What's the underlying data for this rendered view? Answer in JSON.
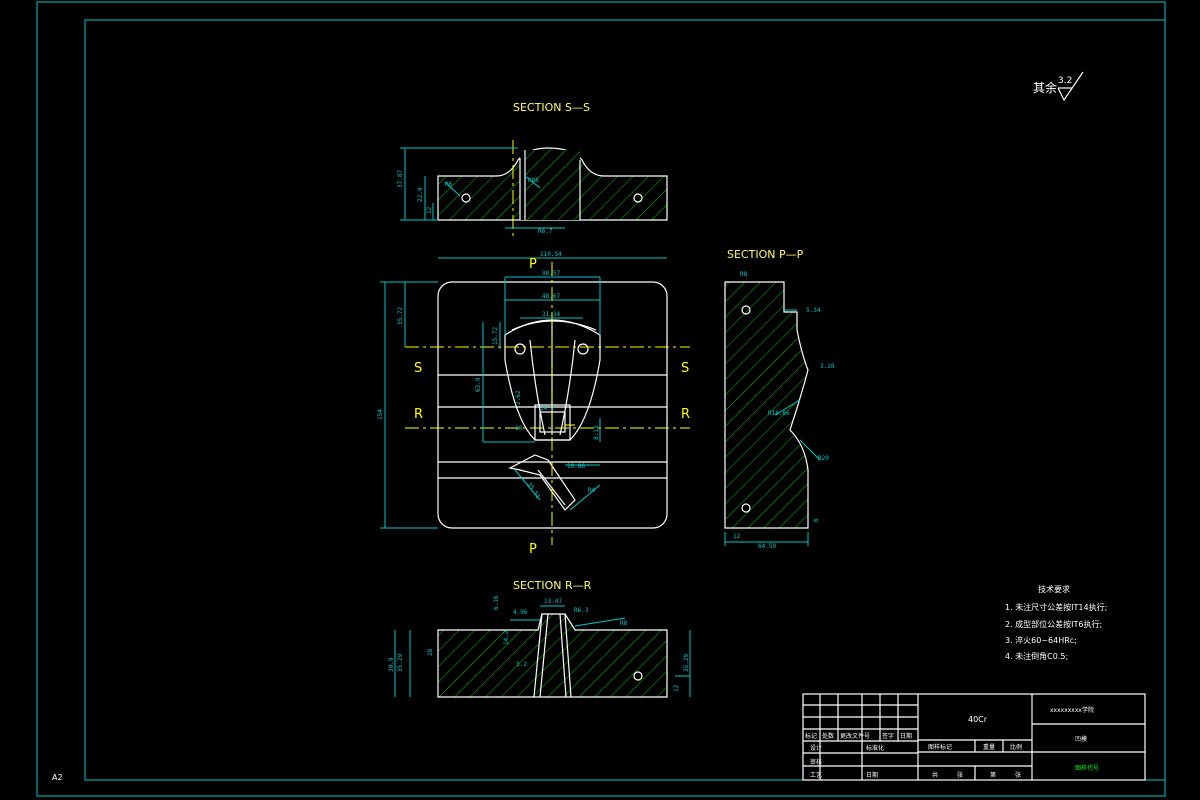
{
  "sheet": {
    "size_label": "A2"
  },
  "sections": {
    "ss": "SECTION S—S",
    "pp": "SECTION P—P",
    "rr": "SECTION R—R"
  },
  "cut_marks": {
    "p": "P",
    "s": "S",
    "r": "R"
  },
  "roughness": {
    "prefix": "其余",
    "value": "3.2"
  },
  "tech_requirements": {
    "title": "技术要求",
    "items": [
      "1. 未注尺寸公差按IT14执行;",
      "2. 成型部位公差按IT6执行;",
      "3. 淬火60~64HRc;",
      "4. 未注倒角C0.5;"
    ]
  },
  "dimensions": {
    "ss": [
      "37.87",
      "22.9",
      "12",
      "R6",
      "R86",
      "R6.7"
    ],
    "plan": [
      "110.54",
      "98.57",
      "48.67",
      "31.34",
      "35.72",
      "15.72",
      "63.9",
      "2.62",
      "14.2",
      "10",
      "8.13",
      "19.86",
      "35.51",
      "R4",
      "154"
    ],
    "pp": [
      "R8",
      "5.34",
      "3.28",
      "R18.66",
      "R20",
      "6",
      "12",
      "64.59"
    ],
    "rr": [
      "6.16",
      "13.47",
      "4.96",
      "R6.3",
      "R8",
      "14.2",
      "3.2",
      "28",
      "35.29",
      "39.9",
      "35.29",
      "12"
    ]
  },
  "title_block": {
    "material": "40Cr",
    "school": "xxxxxxxxx学院",
    "part_name": "凹模",
    "drawing_no": "图样代号",
    "row_labels": [
      "标记",
      "处数",
      "更改文件号",
      "签字",
      "日期"
    ],
    "design": "设计",
    "standardization": "标准化",
    "review": "审核",
    "process": "工艺",
    "date": "日期",
    "stage_mark": "图样标记",
    "weight": "重量",
    "scale": "比例",
    "total": "共",
    "sheet_word": "张",
    "page": "第",
    "page_word": "张"
  }
}
